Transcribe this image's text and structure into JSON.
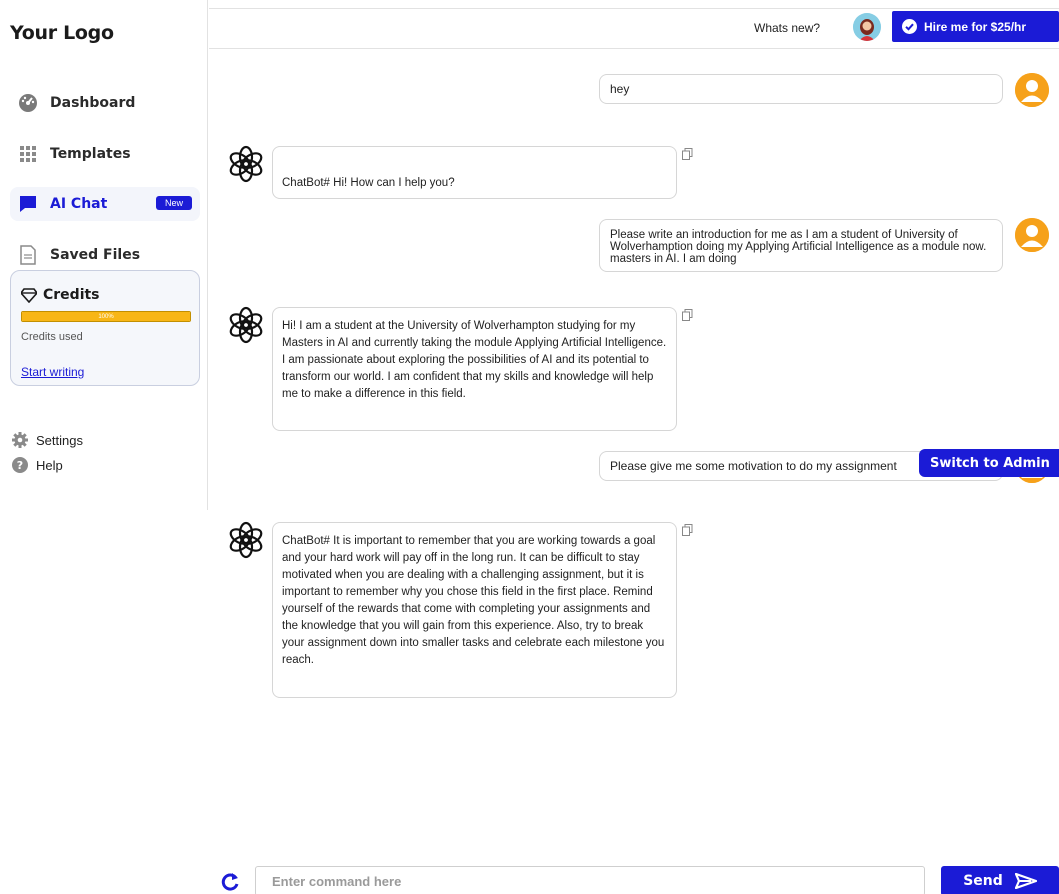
{
  "sidebar": {
    "logo": "Your Logo",
    "nav": [
      {
        "label": "Dashboard",
        "icon": "dashboard-icon"
      },
      {
        "label": "Templates",
        "icon": "grid-icon"
      },
      {
        "label": "AI Chat",
        "icon": "chat-icon",
        "badge": "New",
        "active": true
      },
      {
        "label": "Saved Files",
        "icon": "file-icon"
      }
    ],
    "credits": {
      "title": "Credits",
      "progress_label": "100%",
      "progress": 1.0,
      "used_label": "Credits used",
      "cta": "Start writing"
    },
    "settings": "Settings",
    "help": "Help"
  },
  "header": {
    "whats_new": "Whats new?",
    "hire_label": "Hire me for $25/hr"
  },
  "chat": {
    "messages": [
      {
        "role": "user",
        "text": "hey"
      },
      {
        "role": "bot",
        "text": "ChatBot# Hi! How can I help you?"
      },
      {
        "role": "user",
        "text": "Please write an introduction for me as I am a student of University of Wolverhamption doing my Applying Artificial Intelligence as a module now. masters in AI. I am doing"
      },
      {
        "role": "bot",
        "text": "Hi! I am a student at the University of Wolverhampton studying for my Masters in AI and currently taking the module Applying Artificial Intelligence. I am passionate about exploring the possibilities of AI and its potential to transform our world. I am confident that my skills and knowledge will help me to make a difference in this field."
      },
      {
        "role": "user",
        "text": "Please give me some motivation to do my assignment"
      },
      {
        "role": "bot",
        "text": "ChatBot# It is important to remember that you are working towards a goal and your hard work will pay off in the long run. It can be difficult to stay motivated when you are dealing with a challenging assignment, but it is important to remember why you chose this field in the first place. Remind yourself of the rewards that come with completing your assignments and the knowledge that you will gain from this experience. Also, try to break your assignment down into smaller tasks and celebrate each milestone you reach."
      }
    ]
  },
  "switch_admin": "Switch to Admin",
  "composer": {
    "placeholder": "Enter command here",
    "send_label": "Send"
  },
  "colors": {
    "accent": "#1b1bd6",
    "progress": "#f8b616",
    "user_avatar": "#f6a11a"
  }
}
